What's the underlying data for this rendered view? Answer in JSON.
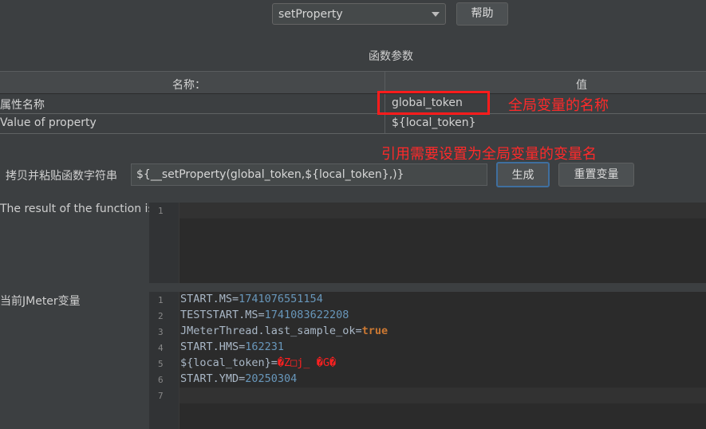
{
  "top": {
    "function_select": "setProperty",
    "help_button": "帮助"
  },
  "params": {
    "section_title": "函数参数",
    "col_name": "名称：",
    "col_value": "值",
    "rows": [
      {
        "name": "属性名称",
        "value": "global_token"
      },
      {
        "name": "Value of property",
        "value": "${local_token}"
      }
    ]
  },
  "annotations": {
    "global_name": "全局变量的名称",
    "reference_note": "引用需要设置为全局变量的变量名"
  },
  "function_string": {
    "label": "拷贝并粘贴函数字符串",
    "value": "${__setProperty(global_token,${local_token},)}",
    "generate_button": "生成",
    "reset_button": "重置变量"
  },
  "result": {
    "label": "The result of the function is",
    "line_numbers": [
      "1"
    ]
  },
  "jmeter_vars": {
    "label": "当前JMeter变量",
    "line_numbers": [
      "1",
      "2",
      "3",
      "4",
      "5",
      "6",
      "7"
    ],
    "lines": [
      {
        "key": "START.MS=",
        "val": "1741076551154"
      },
      {
        "key": "TESTSTART.MS=",
        "val": "1741083622208"
      },
      {
        "key": "JMeterThread.last_sample_ok=",
        "val": "true"
      },
      {
        "key": "START.HMS=",
        "val": "162231"
      },
      {
        "key": "${local_token}=",
        "val": "�Z□j_ �G�"
      },
      {
        "key": "START.YMD=",
        "val": "20250304"
      }
    ]
  },
  "colors": {
    "background": "#3c3f41",
    "editor_bg": "#2b2b2b",
    "annotation_red": "#ff2a2a",
    "number": "#6897bb",
    "keyword": "#cc7832"
  }
}
